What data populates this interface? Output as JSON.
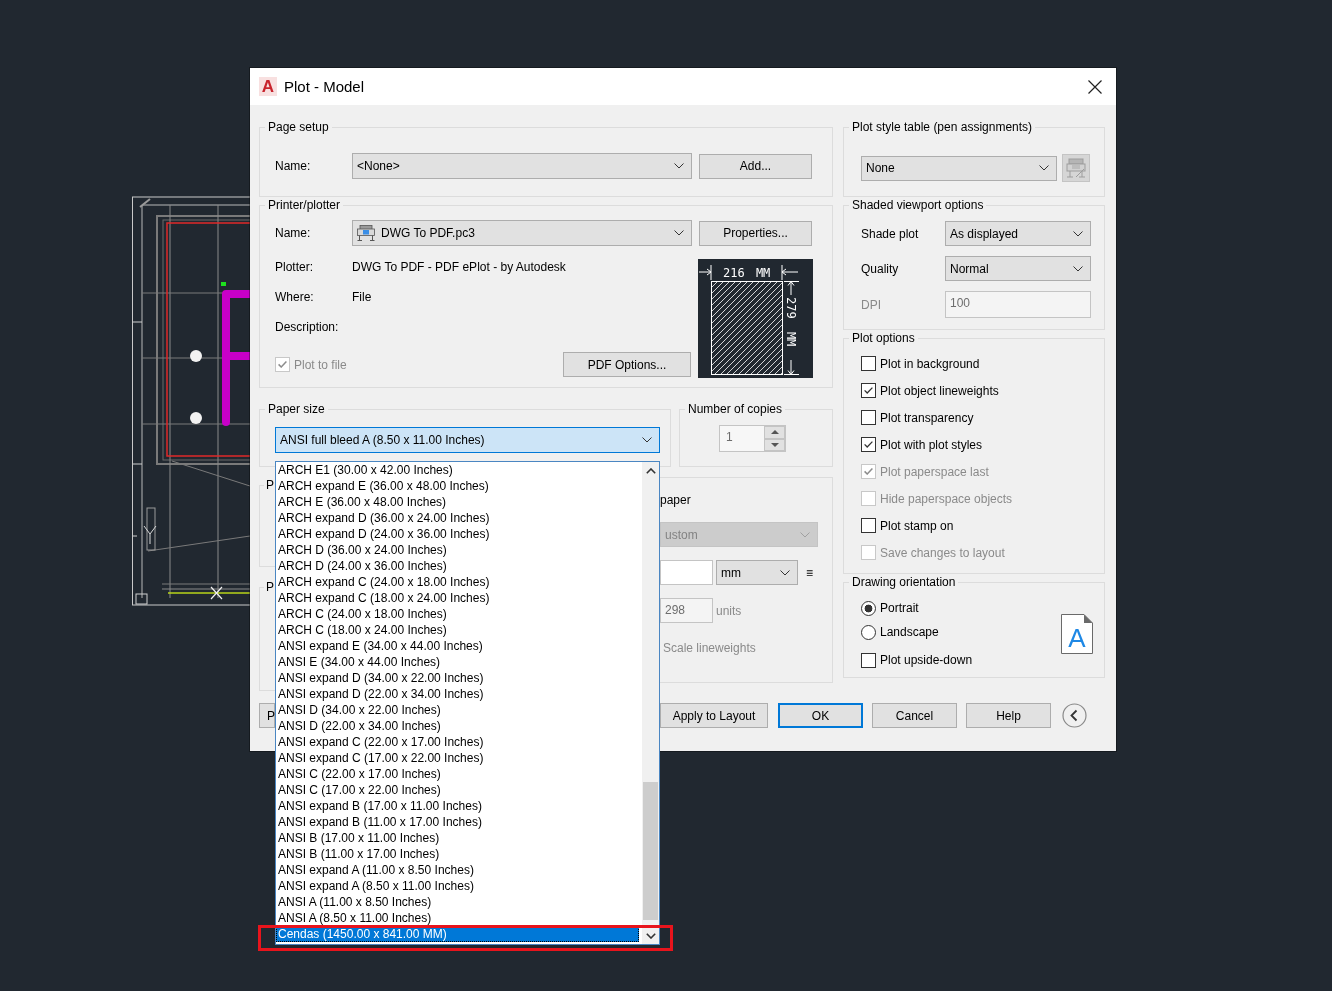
{
  "window": {
    "app_icon_letter": "A",
    "title": "Plot - Model"
  },
  "page_setup": {
    "title": "Page setup",
    "name_label": "Name:",
    "name_value": "<None>",
    "add_button": "Add..."
  },
  "printer_plotter": {
    "title": "Printer/plotter",
    "name_label": "Name:",
    "name_value": "DWG To PDF.pc3",
    "properties_button": "Properties...",
    "details": [
      {
        "label": "Plotter:",
        "value": "DWG To PDF - PDF ePlot - by Autodesk"
      },
      {
        "label": "Where:",
        "value": "File"
      },
      {
        "label": "Description:"
      }
    ],
    "plot_to_file": {
      "label": "Plot to file",
      "checked": true,
      "disabled": true
    },
    "pdf_options_button": "PDF Options...",
    "preview": {
      "width_label": "216 MM",
      "height_label": "279 MM"
    }
  },
  "paper_size": {
    "title": "Paper size",
    "value": "ANSI full bleed A (8.50 x 11.00 Inches)",
    "expanded": true,
    "highlight_selected": true,
    "options": [
      {
        "label": "ARCH E1 (30.00 x 42.00 Inches)",
        "selected": false
      },
      {
        "label": "ARCH expand E (36.00 x 48.00 Inches)",
        "selected": false
      },
      {
        "label": "ARCH E (36.00 x 48.00 Inches)",
        "selected": false
      },
      {
        "label": "ARCH expand D (36.00 x 24.00 Inches)",
        "selected": false
      },
      {
        "label": "ARCH expand D (24.00 x 36.00 Inches)",
        "selected": false
      },
      {
        "label": "ARCH D (36.00 x 24.00 Inches)",
        "selected": false
      },
      {
        "label": "ARCH D (24.00 x 36.00 Inches)",
        "selected": false
      },
      {
        "label": "ARCH expand C (24.00 x 18.00 Inches)",
        "selected": false
      },
      {
        "label": "ARCH expand C (18.00 x 24.00 Inches)",
        "selected": false
      },
      {
        "label": "ARCH C (24.00 x 18.00 Inches)",
        "selected": false
      },
      {
        "label": "ARCH C (18.00 x 24.00 Inches)",
        "selected": false
      },
      {
        "label": "ANSI expand E (34.00 x 44.00 Inches)",
        "selected": false
      },
      {
        "label": "ANSI E (34.00 x 44.00 Inches)",
        "selected": false
      },
      {
        "label": "ANSI expand D (34.00 x 22.00 Inches)",
        "selected": false
      },
      {
        "label": "ANSI expand D (22.00 x 34.00 Inches)",
        "selected": false
      },
      {
        "label": "ANSI D (34.00 x 22.00 Inches)",
        "selected": false
      },
      {
        "label": "ANSI D (22.00 x 34.00 Inches)",
        "selected": false
      },
      {
        "label": "ANSI expand C (22.00 x 17.00 Inches)",
        "selected": false
      },
      {
        "label": "ANSI expand C (17.00 x 22.00 Inches)",
        "selected": false
      },
      {
        "label": "ANSI C (22.00 x 17.00 Inches)",
        "selected": false
      },
      {
        "label": "ANSI C (17.00 x 22.00 Inches)",
        "selected": false
      },
      {
        "label": "ANSI expand B (17.00 x 11.00 Inches)",
        "selected": false
      },
      {
        "label": "ANSI expand B (11.00 x 17.00 Inches)",
        "selected": false
      },
      {
        "label": "ANSI B (17.00 x 11.00 Inches)",
        "selected": false
      },
      {
        "label": "ANSI B (11.00 x 17.00 Inches)",
        "selected": false
      },
      {
        "label": "ANSI expand A (11.00 x 8.50 Inches)",
        "selected": false
      },
      {
        "label": "ANSI expand A (8.50 x 11.00 Inches)",
        "selected": false
      },
      {
        "label": "ANSI A (11.00 x 8.50 Inches)",
        "selected": false
      },
      {
        "label": "ANSI A (8.50 x 11.00 Inches)",
        "selected": false
      },
      {
        "label": "Cendas (1450.00 x 841.00 MM)",
        "selected": true
      }
    ]
  },
  "number_of_copies": {
    "title": "Number of copies",
    "value": "1",
    "disabled": true
  },
  "covered_groups": [
    {
      "title": "P"
    },
    {
      "title": "P"
    }
  ],
  "scale_group": {
    "label": "paper",
    "select": {
      "value": "ustom",
      "disabled": true
    },
    "unit_select": {
      "value": "mm"
    },
    "equals_sign": "≡",
    "units_field": {
      "value": "298",
      "disabled": true
    },
    "units_label": "units",
    "lineweights": {
      "label": "Scale lineweights",
      "disabled": true
    }
  },
  "plot_style_table": {
    "title": "Plot style table (pen assignments)",
    "value": "None",
    "edit_disabled": true
  },
  "shaded_viewport_options": {
    "title": "Shaded viewport options",
    "fields": [
      {
        "kind": "select",
        "label": "Shade plot",
        "value": "As displayed",
        "disabled": false
      },
      {
        "kind": "select",
        "label": "Quality",
        "value": "Normal",
        "disabled": false
      },
      {
        "kind": "input",
        "label": "DPI",
        "value": "100",
        "disabled": true
      }
    ]
  },
  "plot_options": {
    "title": "Plot options",
    "items": [
      {
        "label": "Plot in background",
        "checked": false,
        "disabled": false
      },
      {
        "label": "Plot object lineweights",
        "checked": true,
        "disabled": false
      },
      {
        "label": "Plot transparency",
        "checked": false,
        "disabled": false
      },
      {
        "label": "Plot with plot styles",
        "checked": true,
        "disabled": false
      },
      {
        "label": "Plot paperspace last",
        "checked": true,
        "disabled": true
      },
      {
        "label": "Hide paperspace objects",
        "checked": false,
        "disabled": true
      },
      {
        "label": "Plot stamp on",
        "checked": false,
        "disabled": false
      },
      {
        "label": "Save changes to layout",
        "checked": false,
        "disabled": true
      }
    ]
  },
  "drawing_orientation": {
    "title": "Drawing orientation",
    "options": [
      {
        "kind": "radio",
        "label": "Portrait",
        "selected": true
      },
      {
        "kind": "radio",
        "label": "Landscape",
        "selected": false
      },
      {
        "kind": "checkbox",
        "label": "Plot upside-down",
        "checked": false
      }
    ],
    "icon_letter": "A"
  },
  "buttons": [
    {
      "label": "P",
      "default": false
    },
    {
      "label": "Apply to Layout",
      "default": false
    },
    {
      "label": "OK",
      "default": true
    },
    {
      "label": "Cancel",
      "default": false
    },
    {
      "label": "Help",
      "default": false
    }
  ]
}
